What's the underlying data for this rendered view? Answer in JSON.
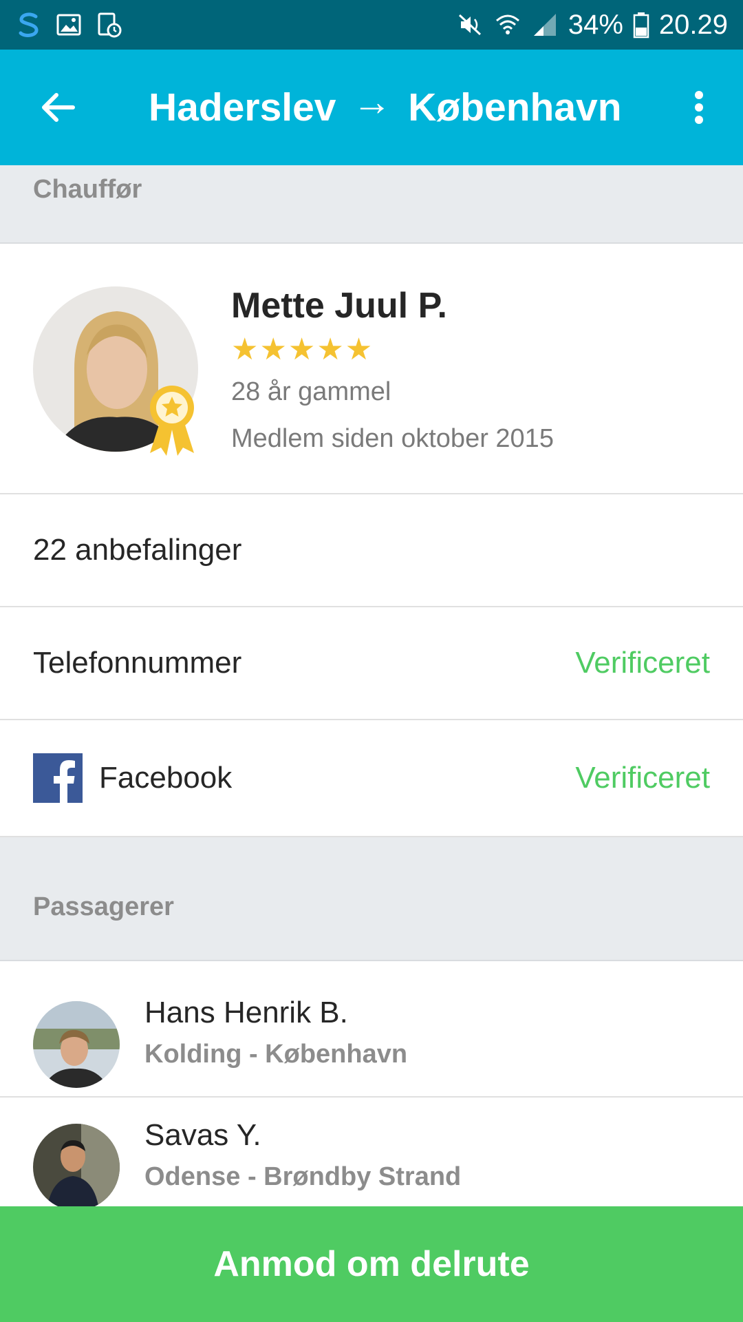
{
  "status_bar": {
    "battery": "34%",
    "time": "20.29",
    "left_icons": [
      "app-s-icon",
      "gallery-icon",
      "calendar-clock-icon"
    ],
    "right_icons": [
      "mute-icon",
      "wifi-icon",
      "signal-icon",
      "battery-icon"
    ]
  },
  "app_bar": {
    "from": "Haderslev",
    "arrow": "→",
    "to": "København"
  },
  "driver_section": {
    "header": "Chauffør",
    "name": "Mette Juul P.",
    "stars": "★★★★★",
    "rating": 5,
    "age": "28 år gammel",
    "member_since": "Medlem siden oktober 2015"
  },
  "recommendations": "22 anbefalinger",
  "verifications": [
    {
      "label": "Telefonnummer",
      "status": "Verificeret"
    },
    {
      "label": "Facebook",
      "status": "Verificeret"
    }
  ],
  "passengers_section": {
    "header": "Passagerer",
    "items": [
      {
        "name": "Hans Henrik B.",
        "route": "Kolding - København"
      },
      {
        "name": "Savas Y.",
        "route": "Odense - Brøndby Strand"
      }
    ]
  },
  "cta": {
    "label": "Anmod om delrute"
  },
  "colors": {
    "status_bar": "#006579",
    "app_bar": "#00b4d9",
    "accent_green": "#4fcb62",
    "star": "#f5c231",
    "facebook": "#3b5998",
    "section_bg": "#e8ebee"
  }
}
